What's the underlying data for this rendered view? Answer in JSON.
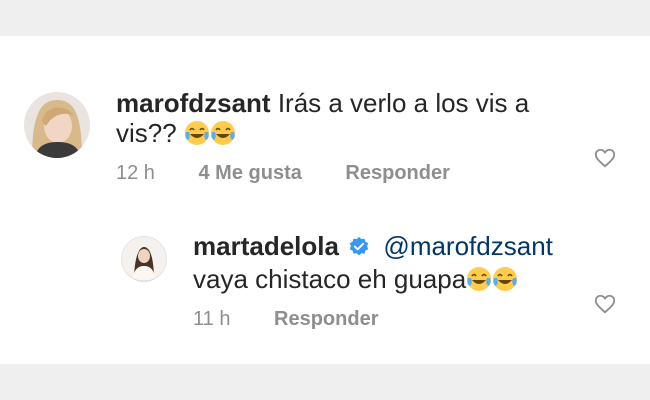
{
  "comments": [
    {
      "username": "marofdzsant",
      "text": "Irás a verlo a los vis a vis??",
      "emojis": [
        "tears-of-joy-emoji",
        "tears-of-joy-emoji"
      ],
      "time": "12 h",
      "likes": "4 Me gusta",
      "reply_label": "Responder"
    },
    {
      "username": "martadelola",
      "verified": true,
      "mention": "@marofdzsant",
      "text": "vaya chistaco eh guapa",
      "emojis": [
        "tears-of-joy-emoji",
        "tears-of-joy-emoji"
      ],
      "time": "11 h",
      "reply_label": "Responder"
    }
  ],
  "colors": {
    "text": "#262626",
    "secondary": "#8e8e8e",
    "mention": "#00376b",
    "verified": "#3897f0",
    "background": "#efefef",
    "card": "#ffffff"
  },
  "icons": [
    "heart-icon",
    "verified-badge-icon"
  ]
}
